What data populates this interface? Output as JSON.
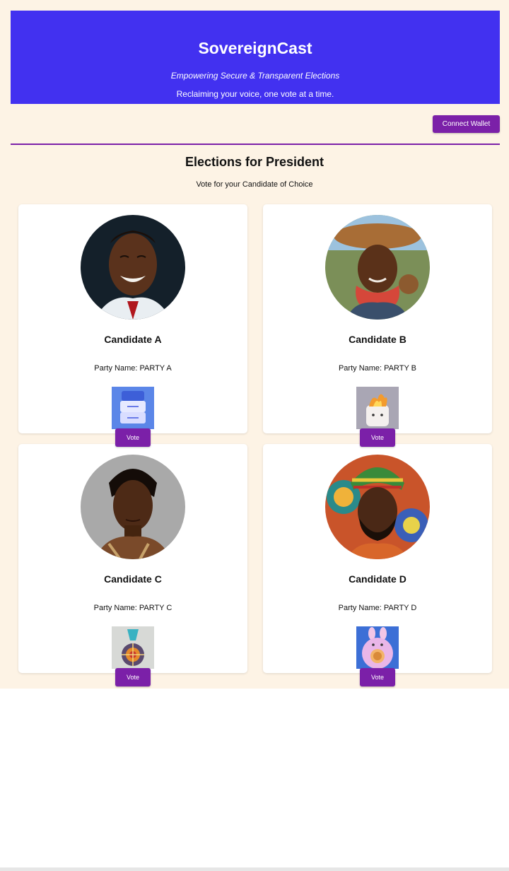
{
  "header": {
    "title": "SovereignCast",
    "tagline": "Empowering Secure & Transparent Elections",
    "subtitle": "Reclaiming your voice, one vote at a time."
  },
  "wallet": {
    "connect_label": "Connect Wallet"
  },
  "election": {
    "title": "Elections for President",
    "subtitle": "Vote for your Candidate of Choice"
  },
  "party_prefix": "Party Name: ",
  "candidates": [
    {
      "name": "Candidate A",
      "party": "PARTY A",
      "vote_label": "Vote"
    },
    {
      "name": "Candidate B",
      "party": "PARTY B",
      "vote_label": "Vote"
    },
    {
      "name": "Candidate C",
      "party": "PARTY C",
      "vote_label": "Vote"
    },
    {
      "name": "Candidate D",
      "party": "PARTY D",
      "vote_label": "Vote"
    }
  ],
  "colors": {
    "page_background": "#fdf3e5",
    "header_background": "#4231f0",
    "accent": "#7b20a8"
  }
}
